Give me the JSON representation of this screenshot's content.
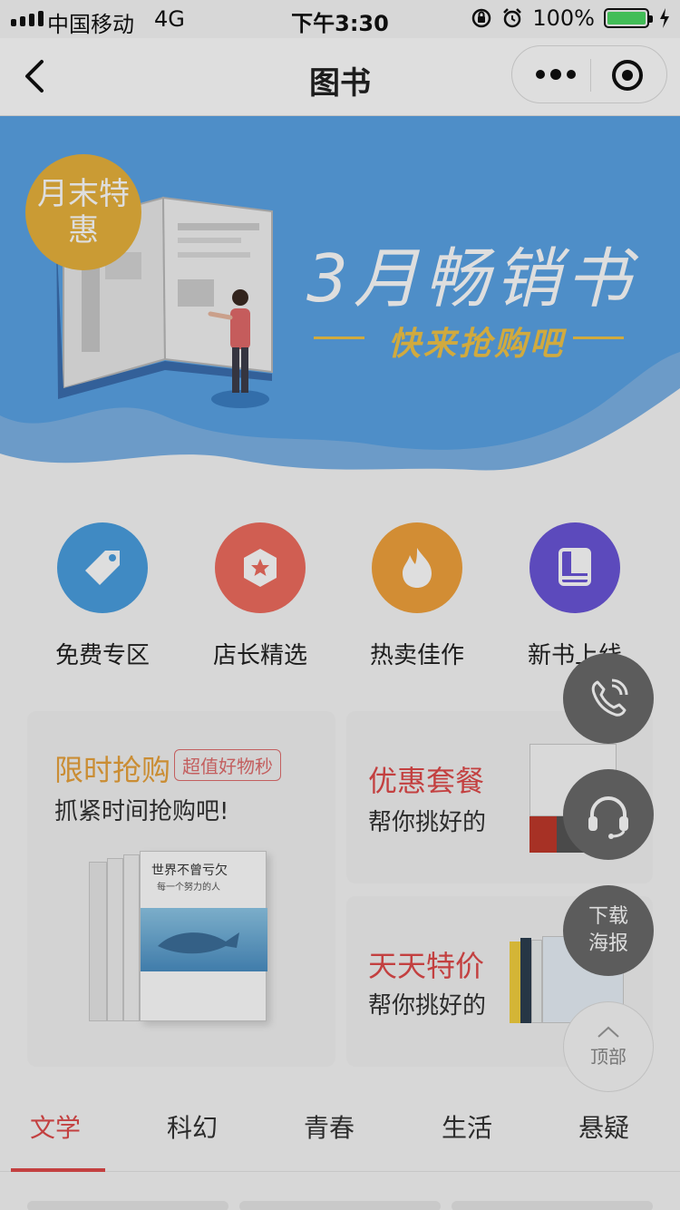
{
  "status_bar": {
    "carrier": "中国移动",
    "network": "4G",
    "time": "下午3:30",
    "battery": "100%",
    "icons": [
      "signal-icon",
      "orientation-lock-icon",
      "alarm-icon",
      "battery-icon",
      "charging-icon"
    ]
  },
  "nav": {
    "title": "图书",
    "icons": [
      "back-icon",
      "more-icon",
      "target-icon"
    ]
  },
  "banner": {
    "badge": "月末特惠",
    "title": "3月畅销书",
    "subtitle": "快来抢购吧",
    "colors": {
      "bg": "#5aa4e6",
      "accent": "#f1c448"
    }
  },
  "categories": [
    {
      "label": "免费专区",
      "icon": "tag-icon",
      "color": "#4a9fe0"
    },
    {
      "label": "店长精选",
      "icon": "star-badge-icon",
      "color": "#ef6c5f"
    },
    {
      "label": "热卖佳作",
      "icon": "flame-icon",
      "color": "#f2a23c"
    },
    {
      "label": "新书上线",
      "icon": "book-icon",
      "color": "#6a55d8"
    }
  ],
  "promo": {
    "flash": {
      "title": "限时抢购",
      "tag": "超值好物秒",
      "subtitle": "抓紧时间抢购吧!",
      "book_title": "世界不曾亏欠",
      "book_subtitle": "每一个努力的人"
    },
    "bundle": {
      "title": "优惠套餐",
      "subtitle": "帮你挑好的"
    },
    "daily": {
      "title": "天天特价",
      "subtitle": "帮你挑好的"
    }
  },
  "floating": {
    "poster": "下载海报",
    "top": "顶部",
    "icons": [
      "phone-icon",
      "headset-icon",
      "chevron-up-icon"
    ]
  },
  "tabs": [
    "文学",
    "科幻",
    "青春",
    "生活",
    "悬疑"
  ],
  "active_tab": "文学"
}
